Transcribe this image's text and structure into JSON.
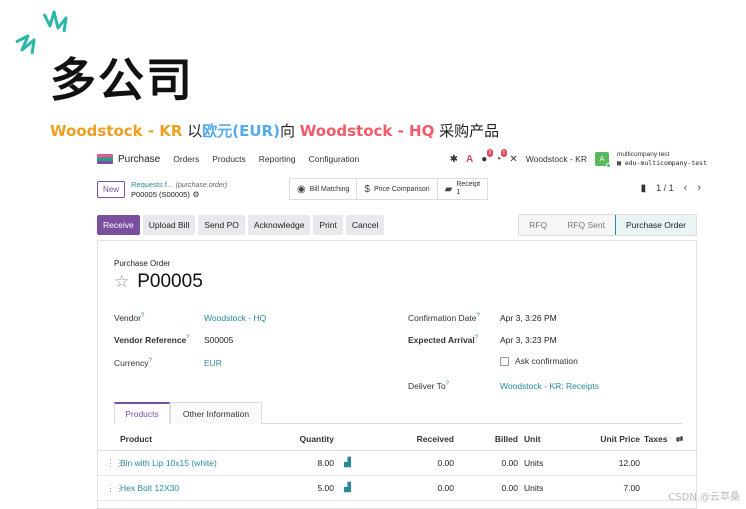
{
  "banner": {
    "title": "多公司",
    "subtitle_part1": "Woodstock - KR",
    "subtitle_part2": " 以",
    "subtitle_part3": "欧元(EUR)",
    "subtitle_part4": "向 ",
    "subtitle_part5": "Woodstock - HQ",
    "subtitle_part6": " 采购产品"
  },
  "navbar": {
    "app_name": "Purchase",
    "menu": [
      "Orders",
      "Products",
      "Reporting",
      "Configuration"
    ],
    "chat_badge": "3",
    "activity_badge": "1",
    "company": "Woodstock - KR",
    "avatar_letter": "A",
    "user_name": "multicompany test",
    "user_db": "edu-multicompany-test"
  },
  "control": {
    "new_label": "New",
    "crumb_link": "Requests f...",
    "crumb_model": "(purchase.order)",
    "crumb_current": "P00005 (S00005)",
    "bill_matching": "Bill Matching",
    "price_comparison": "Price Comparison",
    "receipt_label": "Receipt",
    "receipt_count": "1",
    "pager": "1 / 1"
  },
  "actions": {
    "receive": "Receive",
    "upload_bill": "Upload Bill",
    "send_po": "Send PO",
    "acknowledge": "Acknowledge",
    "print": "Print",
    "cancel": "Cancel"
  },
  "status": {
    "stages": [
      "RFQ",
      "RFQ Sent",
      "Purchase Order"
    ],
    "active": "Purchase Order"
  },
  "form": {
    "type_label": "Purchase Order",
    "name": "P00005",
    "vendor_label": "Vendor",
    "vendor": "Woodstock - HQ",
    "vendor_ref_label": "Vendor Reference",
    "vendor_ref": "S00005",
    "currency_label": "Currency",
    "currency": "EUR",
    "confirmation_label": "Confirmation Date",
    "confirmation": "Apr 3, 3:26 PM",
    "expected_label": "Expected Arrival",
    "expected": "Apr 3, 3:23 PM",
    "ask_confirmation": "Ask confirmation",
    "deliver_label": "Deliver To",
    "deliver": "Woodstock - KR: Receipts",
    "help_mark": "?"
  },
  "tabs": [
    "Products",
    "Other Information"
  ],
  "table": {
    "headers": {
      "product": "Product",
      "quantity": "Quantity",
      "received": "Received",
      "billed": "Billed",
      "unit": "Unit",
      "unit_price": "Unit Price",
      "taxes": "Taxes"
    },
    "rows": [
      {
        "product": "Bin with Lip 10x15 (white)",
        "quantity": "8.00",
        "received": "0.00",
        "billed": "0.00",
        "unit": "Units",
        "price": "12.00"
      },
      {
        "product": "Hex Bolt 12X30",
        "quantity": "5.00",
        "received": "0.00",
        "billed": "0.00",
        "unit": "Units",
        "price": "7.00"
      }
    ]
  },
  "watermark": "CSDN @云草桑",
  "colors": {
    "primary": "#7b4fa0",
    "link": "#2a8a99",
    "title_orange": "#f0a020",
    "title_red": "#f05a6a",
    "title_blue": "#55aaee",
    "sparks": "#2bb8a8"
  }
}
